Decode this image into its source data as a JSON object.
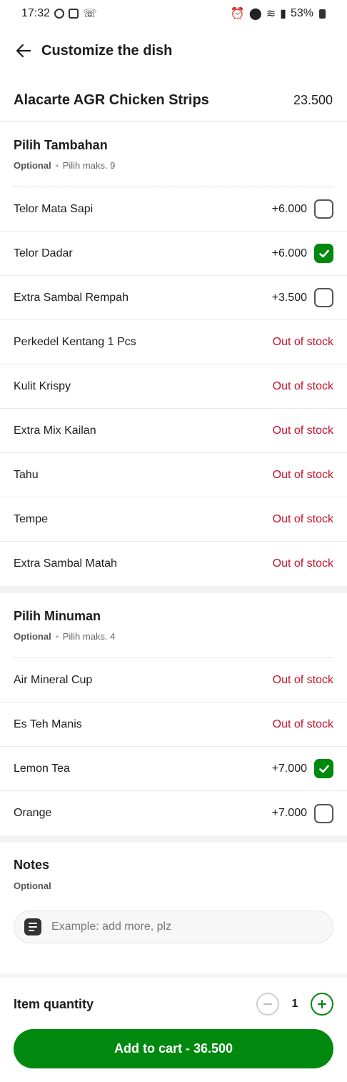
{
  "status_bar": {
    "time": "17:32",
    "battery": "53%"
  },
  "header": {
    "title": "Customize the dish"
  },
  "dish": {
    "name": "Alacarte AGR Chicken Strips",
    "price": "23.500"
  },
  "sections": [
    {
      "title": "Pilih Tambahan",
      "optional_label": "Optional",
      "limit": "Pilih maks. 9",
      "options": [
        {
          "name": "Telor Mata Sapi",
          "price": "+6.000",
          "status": "available",
          "checked": false
        },
        {
          "name": "Telor Dadar",
          "price": "+6.000",
          "status": "available",
          "checked": true
        },
        {
          "name": "Extra Sambal Rempah",
          "price": "+3.500",
          "status": "available",
          "checked": false
        },
        {
          "name": "Perkedel Kentang 1 Pcs",
          "price": "Out of stock",
          "status": "out",
          "checked": false
        },
        {
          "name": "Kulit Krispy",
          "price": "Out of stock",
          "status": "out",
          "checked": false
        },
        {
          "name": "Extra Mix Kailan",
          "price": "Out of stock",
          "status": "out",
          "checked": false
        },
        {
          "name": "Tahu",
          "price": "Out of stock",
          "status": "out",
          "checked": false
        },
        {
          "name": "Tempe",
          "price": "Out of stock",
          "status": "out",
          "checked": false
        },
        {
          "name": "Extra Sambal Matah",
          "price": "Out of stock",
          "status": "out",
          "checked": false
        }
      ]
    },
    {
      "title": "Pilih Minuman",
      "optional_label": "Optional",
      "limit": "Pilih maks. 4",
      "options": [
        {
          "name": "Air Mineral Cup",
          "price": "Out of stock",
          "status": "out",
          "checked": false
        },
        {
          "name": "Es Teh Manis",
          "price": "Out of stock",
          "status": "out",
          "checked": false
        },
        {
          "name": "Lemon Tea",
          "price": "+7.000",
          "status": "available",
          "checked": true
        },
        {
          "name": "Orange",
          "price": "+7.000",
          "status": "available",
          "checked": false
        }
      ]
    }
  ],
  "notes": {
    "title": "Notes",
    "optional_label": "Optional",
    "placeholder": "Example: add more, plz"
  },
  "quantity": {
    "label": "Item quantity",
    "value": "1"
  },
  "cart_button": {
    "label": "Add to cart - 36.500"
  },
  "colors": {
    "primary_green": "#00880f",
    "out_of_stock_red": "#c2132a"
  }
}
